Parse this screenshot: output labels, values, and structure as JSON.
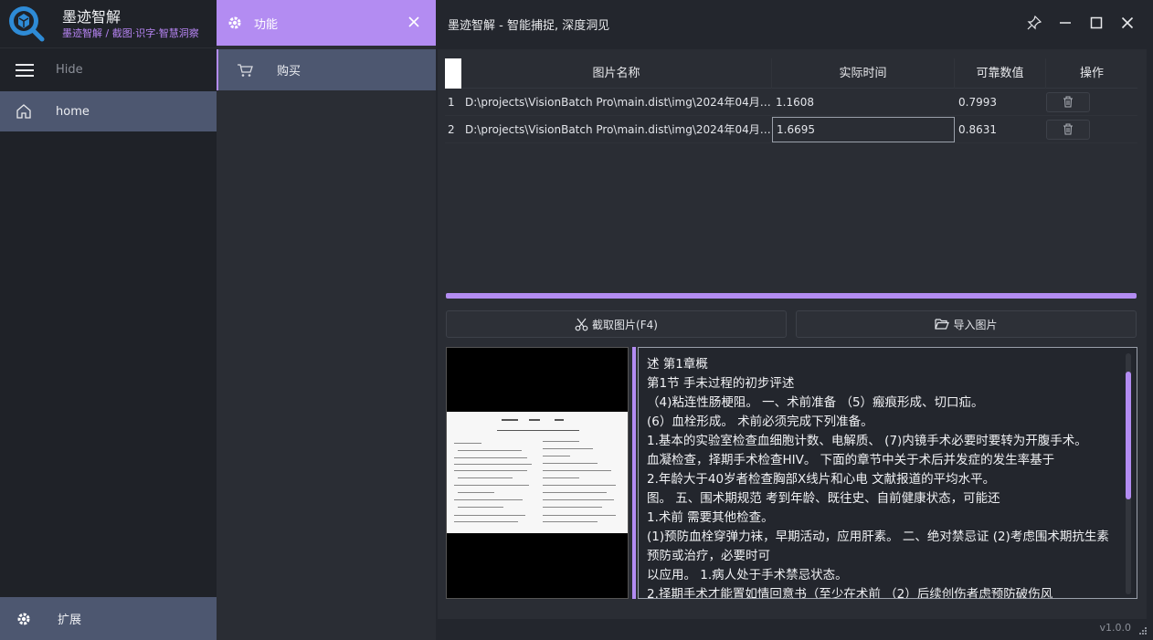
{
  "app": {
    "name": "墨迹智解",
    "slogan": "墨迹智解 / 截图·识字·智慧洞察",
    "window_title": "墨迹智解 - 智能捕捉, 深度洞见",
    "version": "v1.0.0",
    "accent_color": "#b38cf2"
  },
  "sidebar": {
    "hide_label": "Hide",
    "home_label": "home",
    "extend_label": "扩展"
  },
  "panel": {
    "header_label": "功能",
    "items": [
      {
        "label": "购买",
        "icon": "cart-icon"
      }
    ]
  },
  "table": {
    "headers": [
      "图片名称",
      "实际时间",
      "可靠数值",
      "操作"
    ],
    "rows": [
      {
        "index": "1",
        "name": "D:\\projects\\VisionBatch Pro\\main.dist\\img\\2024年04月0...",
        "time": "1.1608",
        "confidence": "0.7993"
      },
      {
        "index": "2",
        "name": "D:\\projects\\VisionBatch Pro\\main.dist\\img\\2024年04月0...",
        "time": "1.6695",
        "confidence": "0.8631"
      }
    ]
  },
  "progress": {
    "value": 1.0
  },
  "buttons": {
    "capture": "截取图片(F4)",
    "import": "导入图片"
  },
  "ocr": {
    "lines": [
      "述 第1章概",
      "第1节 手未过程的初步评述",
      "（4)粘连性肠梗阻。 一、术前准备 （5）瘢痕形成、切口疝。",
      "(6）血栓形成。 术前必须完成下列准备。",
      "1.基本的实验室检查血细胞计数、电解质、 (7)内镜手术必要时要转为开腹手术。",
      "血凝检查，择期手术检查HIV。 下面的章节中关于术后并发症的发生率基于",
      "2.年龄大于40岁者检查胸部X线片和心电 文献报道的平均水平。",
      "图。 五、围术期规范 考到年龄、既往史、自前健康状态，可能还",
      "1.术前 需要其他检查。",
      "(1)预防血栓穿弹力袜，早期活动，应用肝素。 二、绝对禁忌证 (2)考虑围术期抗生素",
      "预防或治疗，必要时可",
      "以应用。 1.病人处于手术禁忌状态。",
      "2.择期手术才能置如情回意书（至少在术前 （2）后续创伤者虑预防破伤风"
    ]
  }
}
